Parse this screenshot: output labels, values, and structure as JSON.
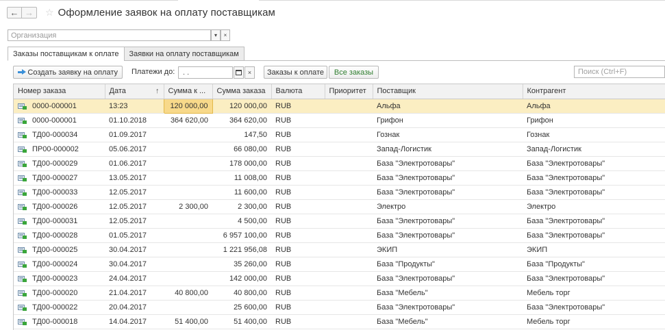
{
  "window": {
    "title": "Оформление заявок на оплату поставщикам",
    "back_glyph": "←",
    "forward_glyph": "→",
    "favorite_glyph": "☆"
  },
  "organization": {
    "placeholder": "Организация",
    "dropdown_glyph": "▾",
    "clear_glyph": "×"
  },
  "tabs": [
    {
      "label": "Заказы поставщикам к оплате",
      "active": true
    },
    {
      "label": "Заявки на оплату поставщикам",
      "active": false
    }
  ],
  "toolbar": {
    "create_label": "Создать заявку на оплату",
    "payments_label": "Платежи до:",
    "date_value": " .  .",
    "date_clear_glyph": "×",
    "orders_to_pay_label": "Заказы к оплате",
    "all_orders_label": "Все заказы",
    "search_placeholder": "Поиск (Ctrl+F)"
  },
  "colors": {
    "accent_blue": "#3a8fd8",
    "selected_row": "#fbeec2",
    "focused_cell": "#f8d98a",
    "all_orders_text": "#2e7d2e"
  },
  "table": {
    "columns": [
      "Номер заказа",
      "Дата",
      "Сумма к ...",
      "Сумма заказа",
      "Валюта",
      "Приоритет",
      "Поставщик",
      "Контрагент"
    ],
    "sort_glyph": "↑",
    "rows": [
      {
        "number": "0000-000001",
        "date": "13:23",
        "due": "120 000,00",
        "total": "120 000,00",
        "currency": "RUB",
        "priority": "",
        "supplier": "Альфа",
        "counterparty": "Альфа",
        "selected": true
      },
      {
        "number": "0000-000001",
        "date": "01.10.2018",
        "due": "364 620,00",
        "total": "364 620,00",
        "currency": "RUB",
        "priority": "",
        "supplier": "Грифон",
        "counterparty": "Грифон"
      },
      {
        "number": "ТД00-000034",
        "date": "01.09.2017",
        "due": "",
        "total": "147,50",
        "currency": "RUB",
        "priority": "",
        "supplier": "Гознак",
        "counterparty": "Гознак"
      },
      {
        "number": "ПР00-000002",
        "date": "05.06.2017",
        "due": "",
        "total": "66 080,00",
        "currency": "RUB",
        "priority": "",
        "supplier": "Запад-Логистик",
        "counterparty": "Запад-Логистик"
      },
      {
        "number": "ТД00-000029",
        "date": "01.06.2017",
        "due": "",
        "total": "178 000,00",
        "currency": "RUB",
        "priority": "",
        "supplier": "База \"Электротовары\"",
        "counterparty": "База \"Электротовары\""
      },
      {
        "number": "ТД00-000027",
        "date": "13.05.2017",
        "due": "",
        "total": "11 008,00",
        "currency": "RUB",
        "priority": "",
        "supplier": "База \"Электротовары\"",
        "counterparty": "База \"Электротовары\""
      },
      {
        "number": "ТД00-000033",
        "date": "12.05.2017",
        "due": "",
        "total": "11 600,00",
        "currency": "RUB",
        "priority": "",
        "supplier": "База \"Электротовары\"",
        "counterparty": "База \"Электротовары\""
      },
      {
        "number": "ТД00-000026",
        "date": "12.05.2017",
        "due": "2 300,00",
        "total": "2 300,00",
        "currency": "RUB",
        "priority": "",
        "supplier": "Электро",
        "counterparty": "Электро"
      },
      {
        "number": "ТД00-000031",
        "date": "12.05.2017",
        "due": "",
        "total": "4 500,00",
        "currency": "RUB",
        "priority": "",
        "supplier": "База \"Электротовары\"",
        "counterparty": "База \"Электротовары\""
      },
      {
        "number": "ТД00-000028",
        "date": "01.05.2017",
        "due": "",
        "total": "6 957 100,00",
        "currency": "RUB",
        "priority": "",
        "supplier": "База \"Электротовары\"",
        "counterparty": "База \"Электротовары\""
      },
      {
        "number": "ТД00-000025",
        "date": "30.04.2017",
        "due": "",
        "total": "1 221 956,08",
        "currency": "RUB",
        "priority": "",
        "supplier": "ЭКИП",
        "counterparty": "ЭКИП"
      },
      {
        "number": "ТД00-000024",
        "date": "30.04.2017",
        "due": "",
        "total": "35 260,00",
        "currency": "RUB",
        "priority": "",
        "supplier": "База \"Продукты\"",
        "counterparty": "База \"Продукты\""
      },
      {
        "number": "ТД00-000023",
        "date": "24.04.2017",
        "due": "",
        "total": "142 000,00",
        "currency": "RUB",
        "priority": "",
        "supplier": "База \"Электротовары\"",
        "counterparty": "База \"Электротовары\""
      },
      {
        "number": "ТД00-000020",
        "date": "21.04.2017",
        "due": "40 800,00",
        "total": "40 800,00",
        "currency": "RUB",
        "priority": "",
        "supplier": "База \"Мебель\"",
        "counterparty": "Мебель торг"
      },
      {
        "number": "ТД00-000022",
        "date": "20.04.2017",
        "due": "",
        "total": "25 600,00",
        "currency": "RUB",
        "priority": "",
        "supplier": "База \"Электротовары\"",
        "counterparty": "База \"Электротовары\""
      },
      {
        "number": "ТД00-000018",
        "date": "14.04.2017",
        "due": "51 400,00",
        "total": "51 400,00",
        "currency": "RUB",
        "priority": "",
        "supplier": "База \"Мебель\"",
        "counterparty": "Мебель торг"
      }
    ]
  }
}
